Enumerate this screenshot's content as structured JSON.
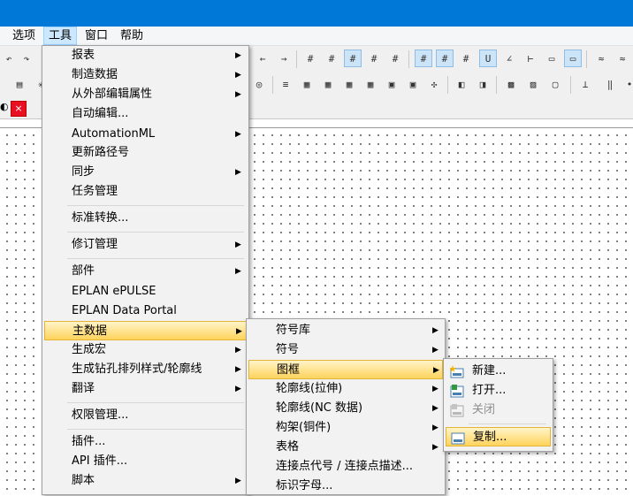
{
  "menubar": {
    "items": [
      "选项",
      "工具",
      "窗口",
      "帮助"
    ]
  },
  "tools_menu": {
    "items": [
      {
        "label": "报表"
      },
      {
        "label": "制造数据"
      },
      {
        "label": "从外部编辑属性"
      },
      {
        "label": "自动编辑..."
      },
      {
        "label": "AutomationML"
      },
      {
        "label": "更新路径号"
      },
      {
        "label": "同步"
      },
      {
        "label": "任务管理"
      },
      {
        "label": "标准转换..."
      },
      {
        "label": "修订管理"
      },
      {
        "label": "部件"
      },
      {
        "label": "EPLAN ePULSE"
      },
      {
        "label": "EPLAN Data Portal"
      },
      {
        "label": "主数据"
      },
      {
        "label": "生成宏"
      },
      {
        "label": "生成钻孔排列样式/轮廓线"
      },
      {
        "label": "翻译"
      },
      {
        "label": "权限管理..."
      },
      {
        "label": "插件..."
      },
      {
        "label": "API 插件..."
      },
      {
        "label": "脚本"
      }
    ]
  },
  "master_data_menu": {
    "items": [
      {
        "label": "符号库"
      },
      {
        "label": "符号"
      },
      {
        "label": "图框"
      },
      {
        "label": "轮廓线(拉伸)"
      },
      {
        "label": "轮廓线(NC 数据)"
      },
      {
        "label": "构架(铜件)"
      },
      {
        "label": "表格"
      },
      {
        "label": "连接点代号 / 连接点描述..."
      },
      {
        "label": "标识字母..."
      }
    ]
  },
  "frame_menu": {
    "items": [
      {
        "label": "新建...",
        "icon": "new-frame-icon"
      },
      {
        "label": "打开...",
        "icon": "open-frame-icon"
      },
      {
        "label": "关闭",
        "icon": "close-frame-icon"
      },
      {
        "label": "复制...",
        "icon": "copy-frame-icon"
      }
    ]
  },
  "document_tab": {
    "close_symbol": "×"
  },
  "colors": {
    "titlebar": "#0078d7",
    "highlight": "#ffd35c",
    "menu_background": "#f2f2f2"
  }
}
